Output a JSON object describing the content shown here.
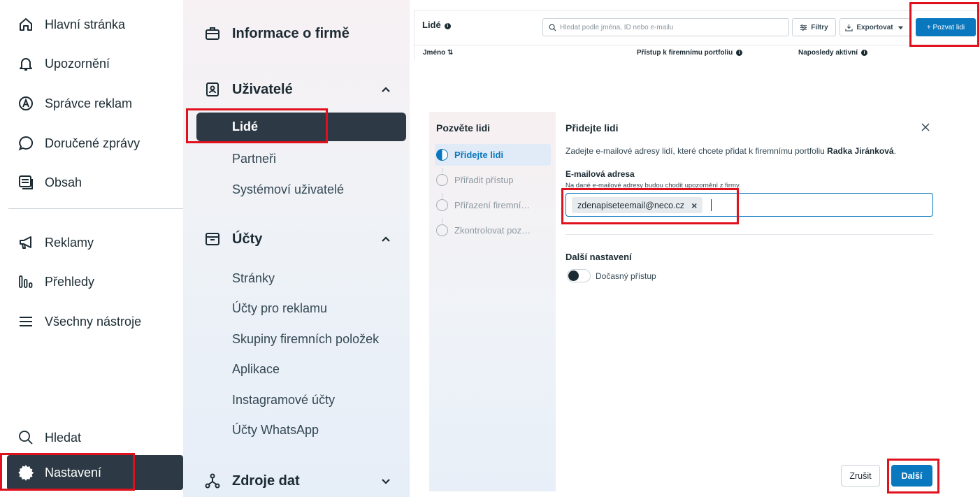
{
  "left_nav": {
    "items": [
      {
        "label": "Hlavní stránka",
        "icon": "home-icon"
      },
      {
        "label": "Upozornění",
        "icon": "bell-icon"
      },
      {
        "label": "Správce reklam",
        "icon": "ads-manager-icon"
      },
      {
        "label": "Doručené zprávy",
        "icon": "chat-bubble-icon"
      },
      {
        "label": "Obsah",
        "icon": "content-icon"
      },
      {
        "label": "Reklamy",
        "icon": "megaphone-icon"
      },
      {
        "label": "Přehledy",
        "icon": "bar-chart-icon"
      },
      {
        "label": "Všechny nástroje",
        "icon": "menu-icon"
      }
    ],
    "search_label": "Hledat",
    "settings_label": "Nastavení"
  },
  "settings_nav": {
    "company_info": "Informace o firmě",
    "users": {
      "title": "Uživatelé",
      "items": [
        "Lidé",
        "Partneři",
        "Systémoví uživatelé"
      ]
    },
    "accounts": {
      "title": "Účty",
      "items": [
        "Stránky",
        "Účty pro reklamu",
        "Skupiny firemních položek",
        "Aplikace",
        "Instagramové účty",
        "Účty WhatsApp"
      ]
    },
    "data_sources": "Zdroje dat"
  },
  "people_panel": {
    "title": "Lidé",
    "search_placeholder": "Hledat podle jména, ID nebo e-mailu",
    "filters_label": "Filtry",
    "export_label": "Exportovat",
    "invite_label": "+ Pozvat lidi",
    "columns": [
      "Jméno ⇅",
      "Přístup k firemnímu portfoliu",
      "Naposledy aktivní"
    ]
  },
  "dialog": {
    "steps_title": "Pozvěte lidi",
    "steps": [
      "Přidejte lidi",
      "Přiřadit přístup",
      "Přiřazení firemní…",
      "Zkontrolovat poz…"
    ],
    "title": "Přidejte lidi",
    "description": "Zadejte e-mailové adresy lidí, které chcete přidat k firemnímu portfoliu ",
    "portfolio_name": "Radka Jiránková",
    "email_label": "E-mailová adresa",
    "email_hint": "Na dané e-mailové adresy budou chodit upozornění z firmy.",
    "email_chip": "zdenapiseteemail@neco.cz",
    "chip_remove": "×",
    "more_settings": "Další nastavení",
    "temp_access_label": "Dočasný přístup",
    "cancel_label": "Zrušit",
    "next_label": "Další"
  },
  "colors": {
    "accent": "#0a78be",
    "dark": "#2d3a45",
    "annotation": "#e0111d"
  }
}
